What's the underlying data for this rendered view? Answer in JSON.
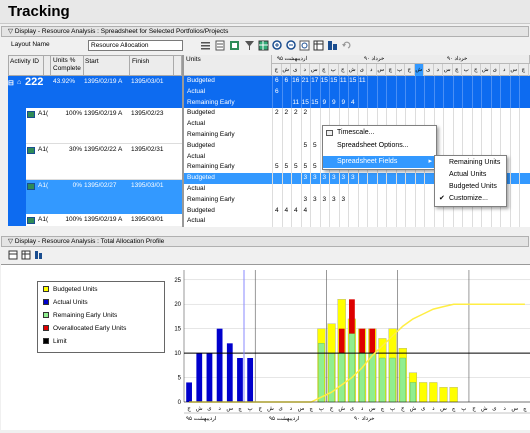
{
  "app": {
    "title": "Tracking"
  },
  "top_panel": {
    "header": "Display - Resource Analysis : Spreadsheet for Selected Portfolios/Projects",
    "layout_label": "Layout Name",
    "layout_value": "Resource Allocation"
  },
  "activity_table": {
    "columns": [
      "Activity ID",
      "Units % Complete",
      "Start",
      "Finish"
    ],
    "rows": [
      {
        "id": "222",
        "units": "43.92%",
        "start": "1395/02/19 A",
        "finish": "1395/03/01",
        "type": "project"
      },
      {
        "id": "A1(",
        "units": "100%",
        "start": "1395/02/19 A",
        "finish": "1395/02/23",
        "type": "activity"
      },
      {
        "id": "A1(",
        "units": "30%",
        "start": "1395/02/22 A",
        "finish": "1395/02/31",
        "type": "activity"
      },
      {
        "id": "A1(",
        "units": "0%",
        "start": "1395/02/27",
        "finish": "1395/03/01",
        "type": "activity_selected"
      },
      {
        "id": "A1(",
        "units": "100%",
        "start": "1395/02/19 A",
        "finish": "1395/03/01",
        "type": "activity"
      }
    ]
  },
  "spreadsheet": {
    "units_header": "Units",
    "months_top": [
      "اردیبهشت ۹۵",
      "خرداد ۹۰",
      "خرداد ۹۰"
    ],
    "days": [
      "ج",
      "ش",
      "ی",
      "د",
      "س",
      "چ",
      "پ",
      "ج",
      "ش",
      "ی",
      "د",
      "س",
      "چ",
      "پ",
      "ج",
      "ش",
      "ی",
      "د",
      "س",
      "چ",
      "پ",
      "ج",
      "ش",
      "ی",
      "د",
      "س",
      "چ"
    ],
    "rows": [
      {
        "label": "Budgeted",
        "values": [
          "6",
          "6",
          "16",
          "21",
          "17",
          "15",
          "15",
          "11",
          "15",
          "11"
        ]
      },
      {
        "label": "Actual",
        "values": [
          "6",
          "",
          "",
          "",
          "",
          "",
          "",
          "",
          "",
          ""
        ]
      },
      {
        "label": "Remaining Early",
        "values": [
          "",
          "",
          "11",
          "15",
          "15",
          "9",
          "9",
          "9",
          "4",
          ""
        ]
      },
      {
        "label": "Budgeted",
        "values": [
          "2",
          "2",
          "2",
          "2",
          "",
          "",
          "",
          "",
          "",
          ""
        ]
      },
      {
        "label": "Actual",
        "values": []
      },
      {
        "label": "Remaining Early",
        "values": []
      },
      {
        "label": "Budgeted",
        "values": [
          "",
          "",
          "",
          "5",
          "5",
          "5",
          "",
          "",
          "",
          ""
        ]
      },
      {
        "label": "Actual",
        "values": []
      },
      {
        "label": "Remaining Early",
        "values": [
          "5",
          "5",
          "5",
          "5",
          "5",
          "5",
          "5",
          "",
          "",
          ""
        ]
      },
      {
        "label": "Budgeted",
        "values": [
          "",
          "",
          "",
          "3",
          "3",
          "3",
          "3",
          "3",
          "3",
          ""
        ]
      },
      {
        "label": "Actual",
        "values": []
      },
      {
        "label": "Remaining Early",
        "values": [
          "",
          "",
          "",
          "3",
          "3",
          "3",
          "3",
          "3",
          "",
          ""
        ]
      },
      {
        "label": "Budgeted",
        "values": [
          "4",
          "4",
          "4",
          "4",
          "",
          "",
          "",
          "",
          "",
          ""
        ]
      },
      {
        "label": "Actual",
        "values": []
      }
    ]
  },
  "context_menu": {
    "items": [
      "Timescale...",
      "Spreadsheet Options...",
      "Spreadsheet Fields"
    ],
    "submenu": [
      "Remaining Units",
      "Actual Units",
      "Budgeted Units",
      "Customize..."
    ],
    "checked": "Customize..."
  },
  "bottom_panel": {
    "header": "Display - Resource Analysis : Total Allocation Profile",
    "legend": [
      {
        "label": "Budgeted Units",
        "color": "#ffff00"
      },
      {
        "label": "Actual Units",
        "color": "#0000cc"
      },
      {
        "label": "Remaining Early Units",
        "color": "#90ee90"
      },
      {
        "label": "Overallocated Early Units",
        "color": "#dd0000"
      },
      {
        "label": "Limit",
        "color": "#000000"
      }
    ],
    "x_month_labels": [
      "اردیبهشت ۹۵",
      "اردیبهشت ۹۵",
      "خرداد ۹۰"
    ]
  },
  "chart_data": {
    "type": "bar",
    "ylim": [
      0,
      27
    ],
    "yticks": [
      "0",
      "5",
      "10",
      "15",
      "20",
      "25"
    ],
    "limit_value": 10,
    "categories": [
      "ج",
      "ش",
      "ی",
      "د",
      "س",
      "چ",
      "پ",
      "ج",
      "ش",
      "ی",
      "د",
      "س",
      "چ",
      "پ",
      "ج",
      "ش",
      "ی",
      "د",
      "س",
      "چ",
      "پ",
      "ج",
      "ش",
      "ی",
      "د",
      "س",
      "چ",
      "پ",
      "ج",
      "ش",
      "ی",
      "د",
      "س",
      "چ"
    ],
    "series": [
      {
        "name": "Budgeted Units",
        "values": [
          0,
          0,
          0,
          0,
          0,
          0,
          0,
          0,
          0,
          0,
          0,
          0,
          0,
          15,
          16,
          21,
          17,
          15,
          15,
          13,
          15,
          11,
          6,
          4,
          4,
          3,
          3,
          0,
          0,
          0,
          0,
          0,
          0,
          0
        ]
      },
      {
        "name": "Actual Units",
        "values": [
          4,
          10,
          10,
          15,
          12,
          9,
          9,
          0,
          0,
          0,
          0,
          0,
          0,
          0,
          0,
          0,
          0,
          0,
          0,
          0,
          0,
          0,
          0,
          0,
          0,
          0,
          0,
          0,
          0,
          0,
          0,
          0,
          0,
          0
        ]
      },
      {
        "name": "Remaining Early Units",
        "values": [
          0,
          0,
          0,
          0,
          0,
          0,
          0,
          0,
          0,
          0,
          0,
          0,
          0,
          12,
          10,
          10,
          14,
          10,
          10,
          9,
          9,
          9,
          4,
          0,
          0,
          0,
          0,
          0,
          0,
          0,
          0,
          0,
          0,
          0
        ]
      },
      {
        "name": "Overallocated Early Units",
        "values": [
          0,
          0,
          0,
          0,
          0,
          0,
          0,
          0,
          0,
          0,
          0,
          0,
          0,
          0,
          0,
          5,
          7,
          5,
          5,
          0,
          0,
          0,
          0,
          0,
          0,
          0,
          0,
          0,
          0,
          0,
          0,
          0,
          0,
          0
        ]
      }
    ],
    "cumulative_curve": [
      0,
      0,
      0,
      0,
      0,
      0,
      0,
      0,
      0,
      0,
      0,
      0,
      0,
      1,
      2,
      3.5,
      5,
      7,
      9.5,
      11.5,
      13.5,
      15.5,
      17,
      18,
      19,
      19.5,
      20,
      20,
      20,
      20,
      20,
      20,
      20,
      20
    ],
    "legend_position": "top-left"
  }
}
